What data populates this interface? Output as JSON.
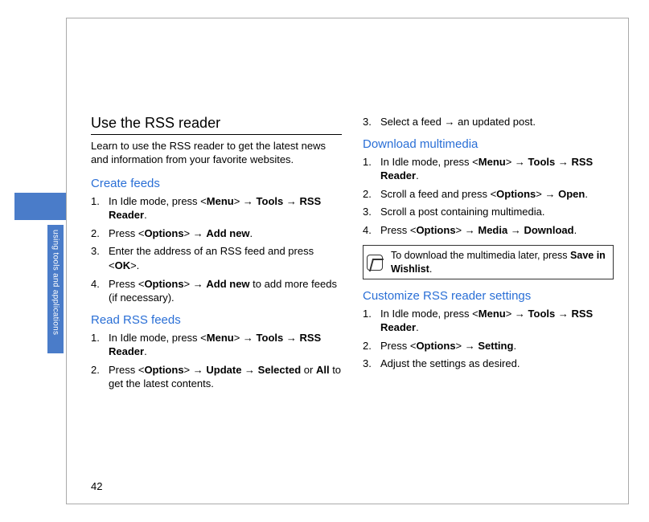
{
  "sideLabel": "using tools and applications",
  "pageNumber": "42",
  "left": {
    "mainTitle": "Use the RSS reader",
    "intro": "Learn to use the RSS reader to get the latest news and information from your favorite websites.",
    "sections": [
      {
        "title": "Create feeds",
        "steps": [
          {
            "pre": "In Idle mode, press <",
            "b1": "Menu",
            "mid1": "> → ",
            "b2": "Tools",
            "mid2": " → ",
            "b3": "RSS Reader",
            "post": "."
          },
          {
            "pre": "Press <",
            "b1": "Options",
            "mid1": "> → ",
            "b2": "Add new",
            "post": "."
          },
          {
            "pre": "Enter the address of an RSS feed and press <",
            "b1": "OK",
            "post": ">."
          },
          {
            "pre": "Press <",
            "b1": "Options",
            "mid1": "> → ",
            "b2": "Add new",
            "post": " to add more feeds (if necessary)."
          }
        ]
      },
      {
        "title": "Read RSS feeds",
        "steps": [
          {
            "pre": "In Idle mode, press <",
            "b1": "Menu",
            "mid1": "> → ",
            "b2": "Tools",
            "mid2": " → ",
            "b3": "RSS Reader",
            "post": "."
          },
          {
            "pre": "Press <",
            "b1": "Options",
            "mid1": "> → ",
            "b2": "Update",
            "mid2": " → ",
            "b3": "Selected",
            "mid3": " or ",
            "b4": "All",
            "post": " to get the latest contents."
          }
        ]
      }
    ]
  },
  "right": {
    "continuation": [
      {
        "pre": "Select a feed → an updated post."
      }
    ],
    "continuationStart": 3,
    "sections": [
      {
        "title": "Download multimedia",
        "steps": [
          {
            "pre": "In Idle mode, press <",
            "b1": "Menu",
            "mid1": "> → ",
            "b2": "Tools",
            "mid2": " → ",
            "b3": "RSS Reader",
            "post": "."
          },
          {
            "pre": "Scroll a feed and press <",
            "b1": "Options",
            "mid1": "> → ",
            "b2": "Open",
            "post": "."
          },
          {
            "pre": "Scroll a post containing multimedia."
          },
          {
            "pre": "Press <",
            "b1": "Options",
            "mid1": "> → ",
            "b2": "Media",
            "mid2": " → ",
            "b3": "Download",
            "post": "."
          }
        ],
        "note": {
          "pre": "To download the multimedia later, press ",
          "b1": "Save in Wishlist",
          "post": "."
        }
      },
      {
        "title": "Customize RSS reader settings",
        "steps": [
          {
            "pre": "In Idle mode, press <",
            "b1": "Menu",
            "mid1": "> → ",
            "b2": "Tools",
            "mid2": " → ",
            "b3": "RSS Reader",
            "post": "."
          },
          {
            "pre": "Press <",
            "b1": "Options",
            "mid1": "> → ",
            "b2": "Setting",
            "post": "."
          },
          {
            "pre": "Adjust the settings as desired."
          }
        ]
      }
    ]
  }
}
